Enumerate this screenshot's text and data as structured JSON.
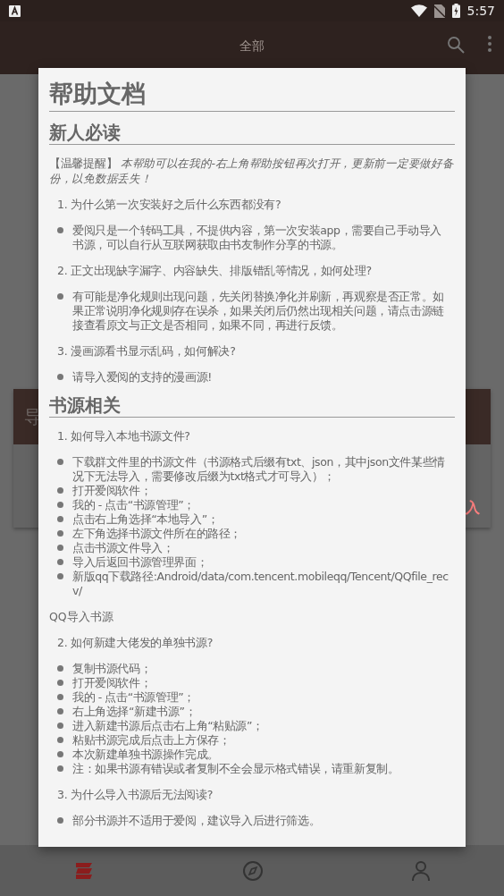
{
  "status_bar": {
    "time": "5:57"
  },
  "app_bar": {
    "tabs": [
      {
        "label": "全部",
        "selected": true
      }
    ]
  },
  "background_card": {
    "title": "导",
    "action": "入"
  },
  "dialog": {
    "title": "帮助文档",
    "sections": [
      {
        "heading": "新人必读",
        "blocks": [
          {
            "kind": "note",
            "text": "【温馨提醒】 *本帮助可以在我的-右上角帮助按钮再次打开，更新前一定要做好备份，以免数据丢失！*"
          },
          {
            "kind": "question",
            "number": "1.",
            "text": "为什么第一次安装好之后什么东西都没有?"
          },
          {
            "kind": "bullets",
            "items": [
              "爱阅只是一个转码工具，不提供内容，第一次安装app，需要自己手动导入书源，可以自行从互联网获取由书友制作分享的书源。"
            ]
          },
          {
            "kind": "question",
            "number": "2.",
            "text": "正文出现缺字漏字、内容缺失、排版错乱等情况，如何处理?"
          },
          {
            "kind": "bullets",
            "items": [
              "有可能是净化规则出现问题，先关闭替换净化并刷新，再观察是否正常。如果正常说明净化规则存在误杀，如果关闭后仍然出现相关问题，请点击源链接查看原文与正文是否相同，如果不同，再进行反馈。"
            ]
          },
          {
            "kind": "question",
            "number": "3.",
            "text": "漫画源看书显示乱码，如何解决?"
          },
          {
            "kind": "bullets",
            "items": [
              "请导入爱阅的支持的漫画源!"
            ]
          }
        ]
      },
      {
        "heading": "书源相关",
        "blocks": [
          {
            "kind": "question",
            "number": "1.",
            "text": "如何导入本地书源文件?"
          },
          {
            "kind": "bullets",
            "items": [
              "下载群文件里的书源文件（书源格式后缀有txt、json，其中json文件某些情况下无法导入，需要修改后缀为txt格式才可导入）；",
              "打开爱阅软件；",
              "我的 - 点击“书源管理”；",
              "点击右上角选择“本地导入”；",
              "左下角选择书源文件所在的路径；",
              "点击书源文件导入；",
              "导入后返回书源管理界面；",
              "新版qq下载路径:Android/data/com.tencent.mobileqq/Tencent/QQfile_recv/"
            ]
          },
          {
            "kind": "paragraph",
            "text": "QQ导入书源"
          },
          {
            "kind": "question",
            "number": "2.",
            "text": "如何新建大佬发的单独书源?"
          },
          {
            "kind": "bullets",
            "items": [
              "复制书源代码；",
              "打开爱阅软件；",
              "我的 - 点击“书源管理”；",
              "右上角选择“新建书源”；",
              "进入新建书源后点击右上角“粘贴源”；",
              "粘贴书源完成后点击上方保存；",
              "本次新建单独书源操作完成。",
              "注：如果书源有错误或者复制不全会显示格式错误，请重新复制。"
            ]
          },
          {
            "kind": "question",
            "number": "3.",
            "text": "为什么导入书源后无法阅读?"
          },
          {
            "kind": "bullets",
            "items": [
              "部分书源并不适用于爱阅，建议导入后进行筛选。"
            ]
          }
        ]
      }
    ]
  },
  "bottom_nav": [
    {
      "kind": "bookshelf",
      "selected": true
    },
    {
      "kind": "compass",
      "selected": false
    },
    {
      "kind": "person",
      "selected": false
    }
  ]
}
